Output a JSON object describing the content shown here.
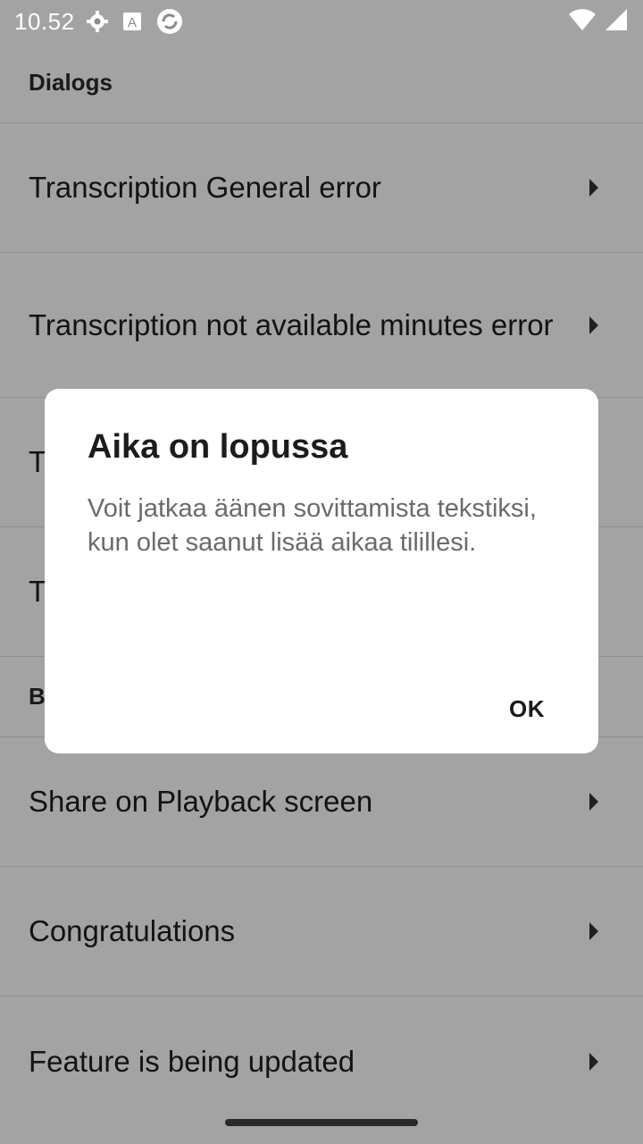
{
  "status_bar": {
    "time": "10.52",
    "left_icons": [
      "gear-icon",
      "a-icon",
      "sync-icon"
    ],
    "right_icons": [
      "wifi-icon",
      "cellular-signal-icon"
    ]
  },
  "list": {
    "dialogs_header": "Dialogs",
    "dialog_items": [
      {
        "label": "Transcription General error"
      },
      {
        "label": "Transcription not available minutes error"
      },
      {
        "label": "T"
      },
      {
        "label": "T"
      }
    ],
    "second_header": "B",
    "more_items": [
      {
        "label": "Share on Playback screen"
      },
      {
        "label": "Congratulations"
      },
      {
        "label": "Feature is being updated"
      }
    ]
  },
  "dialog": {
    "title": "Aika on lopussa",
    "message": "Voit jatkaa äänen sovittamista tekstiksi, kun olet saanut lisää aikaa tilillesi.",
    "ok_label": "OK"
  },
  "colors": {
    "scrim": "#5c5c5c",
    "dialog_bg": "#ffffff",
    "title_text": "#1c1c1c",
    "message_text": "#6b6b6b"
  }
}
